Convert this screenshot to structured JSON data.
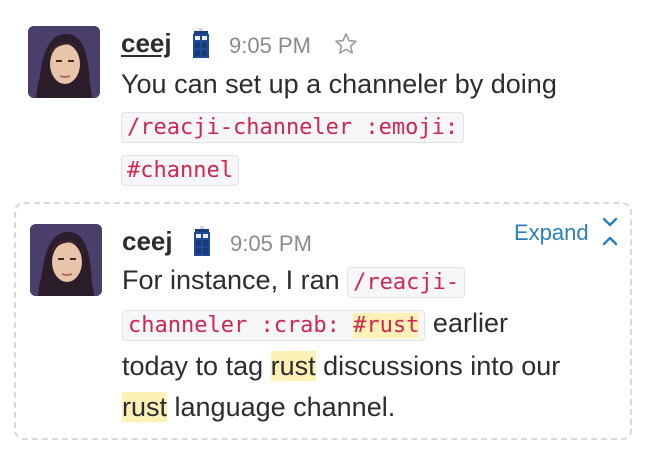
{
  "message1": {
    "author": "ceej",
    "time": "9:05 PM",
    "text_before": "You can set up a channeler by doing",
    "code_line1": "/reacji-channeler :emoji:",
    "code_line2": "#channel"
  },
  "message2": {
    "author": "ceej",
    "time": "9:05 PM",
    "expand_label": "Expand",
    "text_intro": "For instance, I ran",
    "code_part1": "/reacji-",
    "code_part2": "channeler :crab: ",
    "code_highlight": "#rust",
    "text_after_code": "earlier",
    "line3_a": "today to tag ",
    "line3_highlight": "rust",
    "line3_b": " discussions into our",
    "line4_highlight": "rust",
    "line4_b": " language channel."
  },
  "colors": {
    "code_text": "#d0274f",
    "link_blue": "#2a80b9",
    "highlight": "#fdf1b5",
    "timestamp": "#8a8b8e"
  },
  "icons": [
    "avatar",
    "tardis-icon",
    "star-icon",
    "expand-chevron-icon"
  ]
}
